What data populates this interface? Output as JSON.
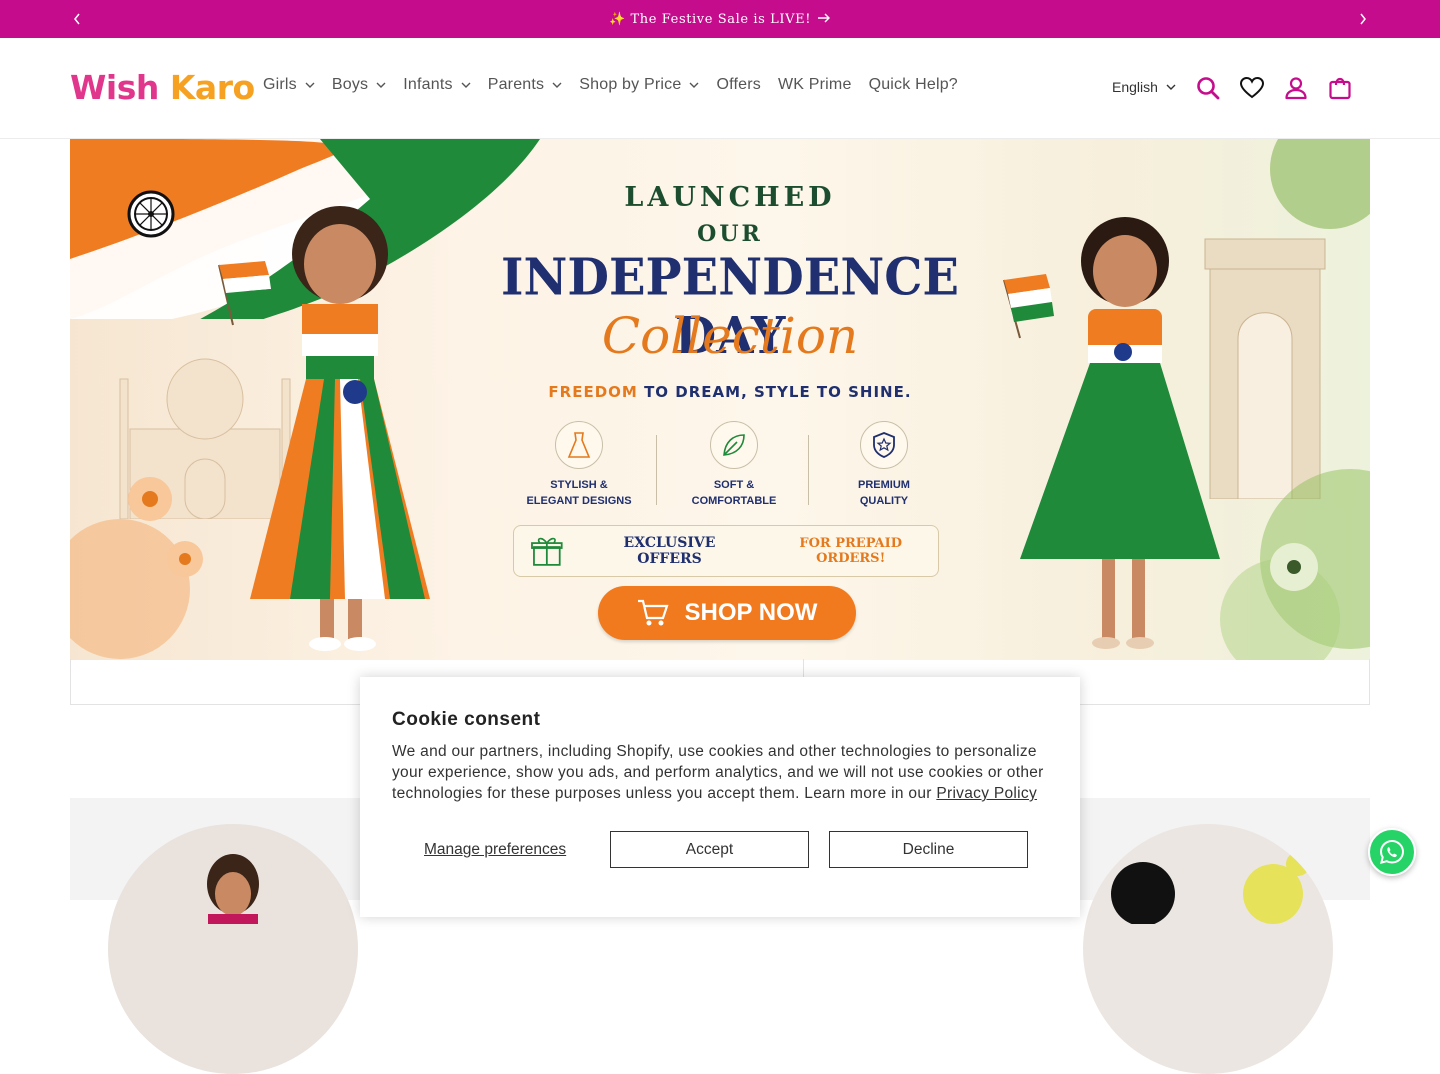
{
  "announcement": {
    "text": "✨ The Festive Sale is LIVE!",
    "prev_icon": "chevron-left-icon",
    "next_icon": "chevron-right-icon",
    "arrow_icon": "arrow-right-icon",
    "bg_color": "#c50c8d"
  },
  "header": {
    "logo_part1": "Wish",
    "logo_part2": "Karo",
    "nav": [
      {
        "label": "Girls",
        "has_dropdown": true
      },
      {
        "label": "Boys",
        "has_dropdown": true
      },
      {
        "label": "Infants",
        "has_dropdown": true
      },
      {
        "label": "Parents",
        "has_dropdown": true
      },
      {
        "label": "Shop by Price",
        "has_dropdown": true
      },
      {
        "label": "Offers",
        "has_dropdown": false
      },
      {
        "label": "WK Prime",
        "has_dropdown": false
      },
      {
        "label": "Quick Help?",
        "has_dropdown": false
      }
    ],
    "language": "English",
    "icons": [
      "search-icon",
      "heart-icon",
      "user-icon",
      "cart-icon"
    ],
    "accent_color": "#c50c8d"
  },
  "hero": {
    "line1": "LAUNCHED",
    "line2": "OUR",
    "line3": "INDEPENDENCE DAY",
    "line4": "Collection",
    "tagline_a": "FREEDOM",
    "tagline_b": "TO DREAM, STYLE TO SHINE.",
    "features": [
      {
        "line1": "STYLISH &",
        "line2": "ELEGANT DESIGNS"
      },
      {
        "line1": "SOFT &",
        "line2": "COMFORTABLE"
      },
      {
        "line1": "PREMIUM",
        "line2": "QUALITY"
      }
    ],
    "offer_a": "EXCLUSIVE OFFERS",
    "offer_b": "FOR PREPAID ORDERS!",
    "cta": "SHOP NOW",
    "colors": {
      "saffron": "#f17a1f",
      "green": "#1f8a3a",
      "navy": "#1f2f6f"
    }
  },
  "cookie": {
    "title": "Cookie consent",
    "body": "We and our partners, including Shopify, use cookies and other technologies to personalize your experience, show you ads, and perform analytics, and we will not use cookies or other technologies for these purposes unless you accept them. Learn more in our ",
    "link": "Privacy Policy",
    "manage": "Manage preferences",
    "accept": "Accept",
    "decline": "Decline"
  },
  "whatsapp": {
    "icon": "whatsapp-icon",
    "color": "#25d366"
  }
}
